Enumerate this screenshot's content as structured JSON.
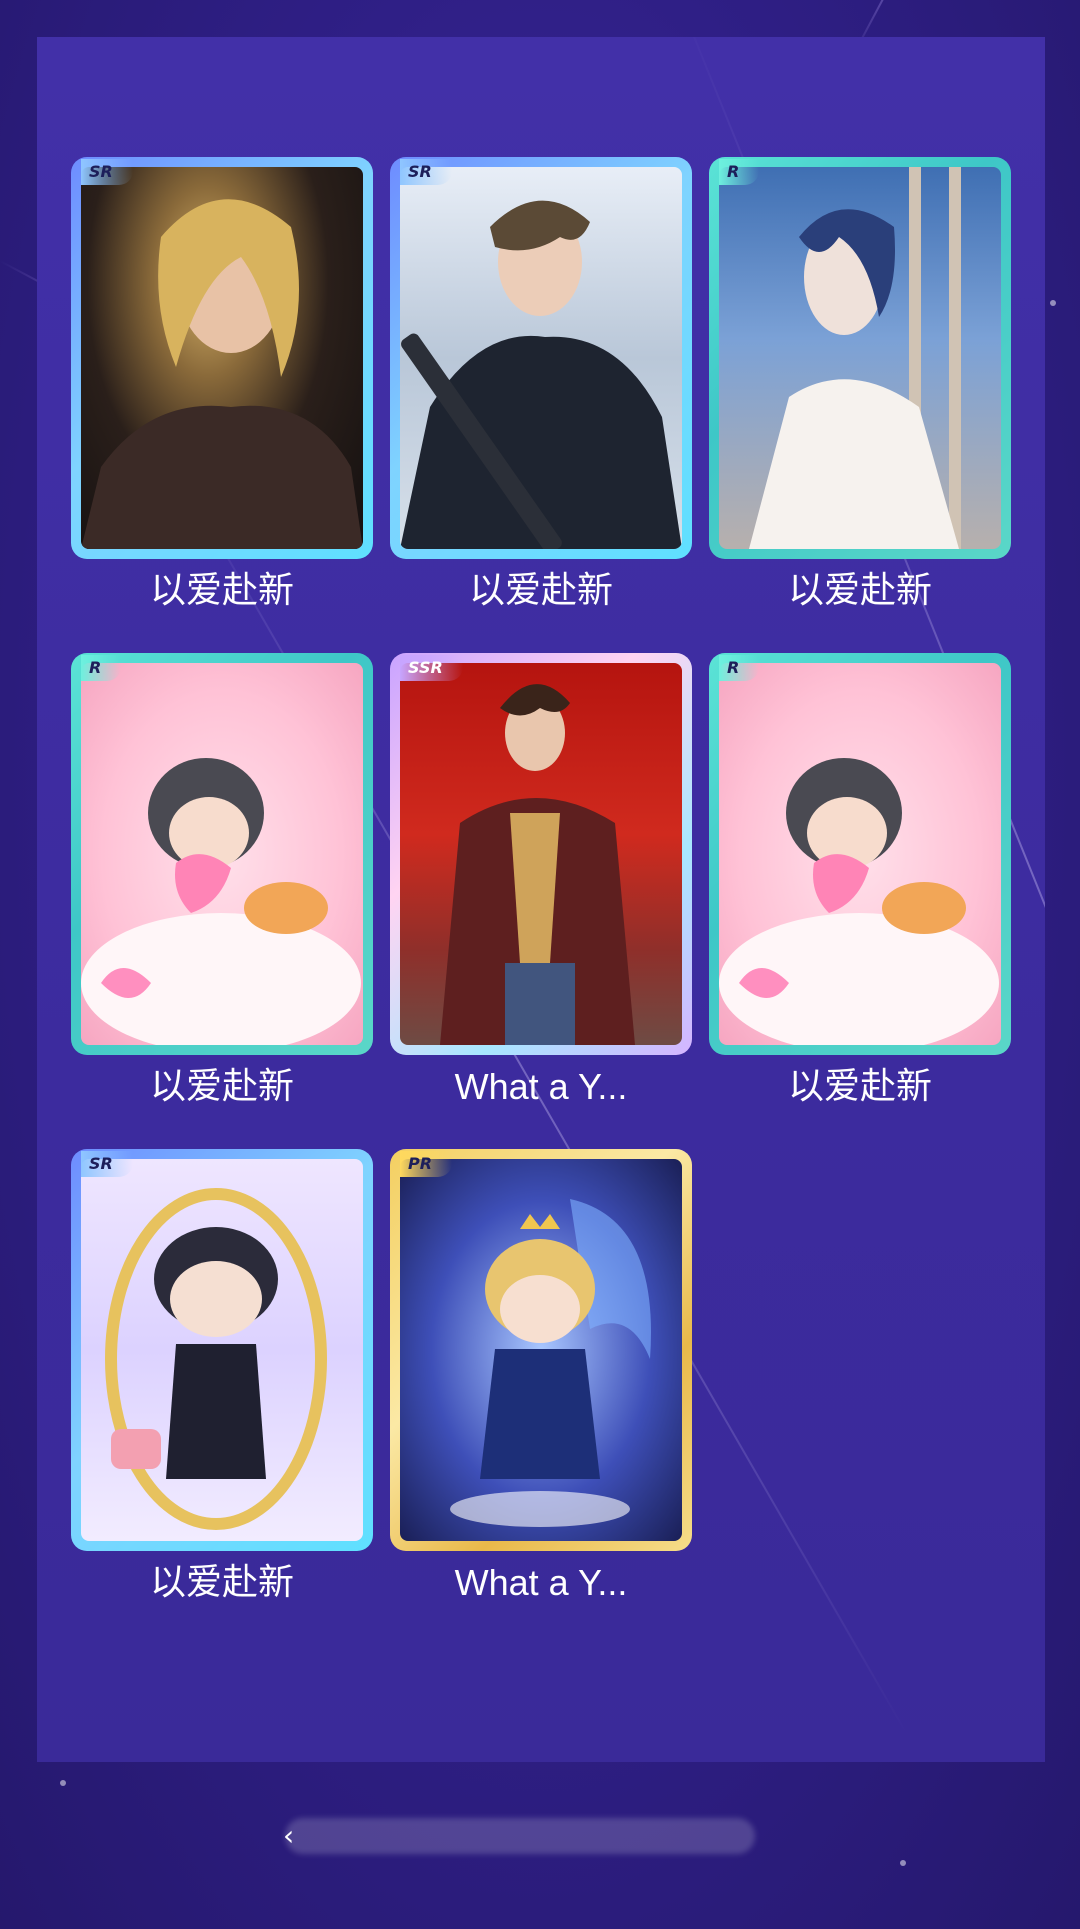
{
  "cards": [
    {
      "rarity": "SR",
      "title": "以爱赴新"
    },
    {
      "rarity": "SR",
      "title": "以爱赴新"
    },
    {
      "rarity": "R",
      "title": "以爱赴新"
    },
    {
      "rarity": "R",
      "title": "以爱赴新"
    },
    {
      "rarity": "SSR",
      "title": "What a Y..."
    },
    {
      "rarity": "R",
      "title": "以爱赴新"
    },
    {
      "rarity": "SR",
      "title": "以爱赴新"
    },
    {
      "rarity": "PR",
      "title": "What a Y..."
    }
  ],
  "footer": {
    "back_icon": "chevron-left-icon"
  },
  "colors": {
    "background": "#2f1f86",
    "panel": "#3f2fa4",
    "frame_r": "#4fd6cc",
    "frame_sr": "#79b4ff",
    "frame_ssr": "#d5b4ff",
    "frame_pr": "#f3cf61"
  }
}
